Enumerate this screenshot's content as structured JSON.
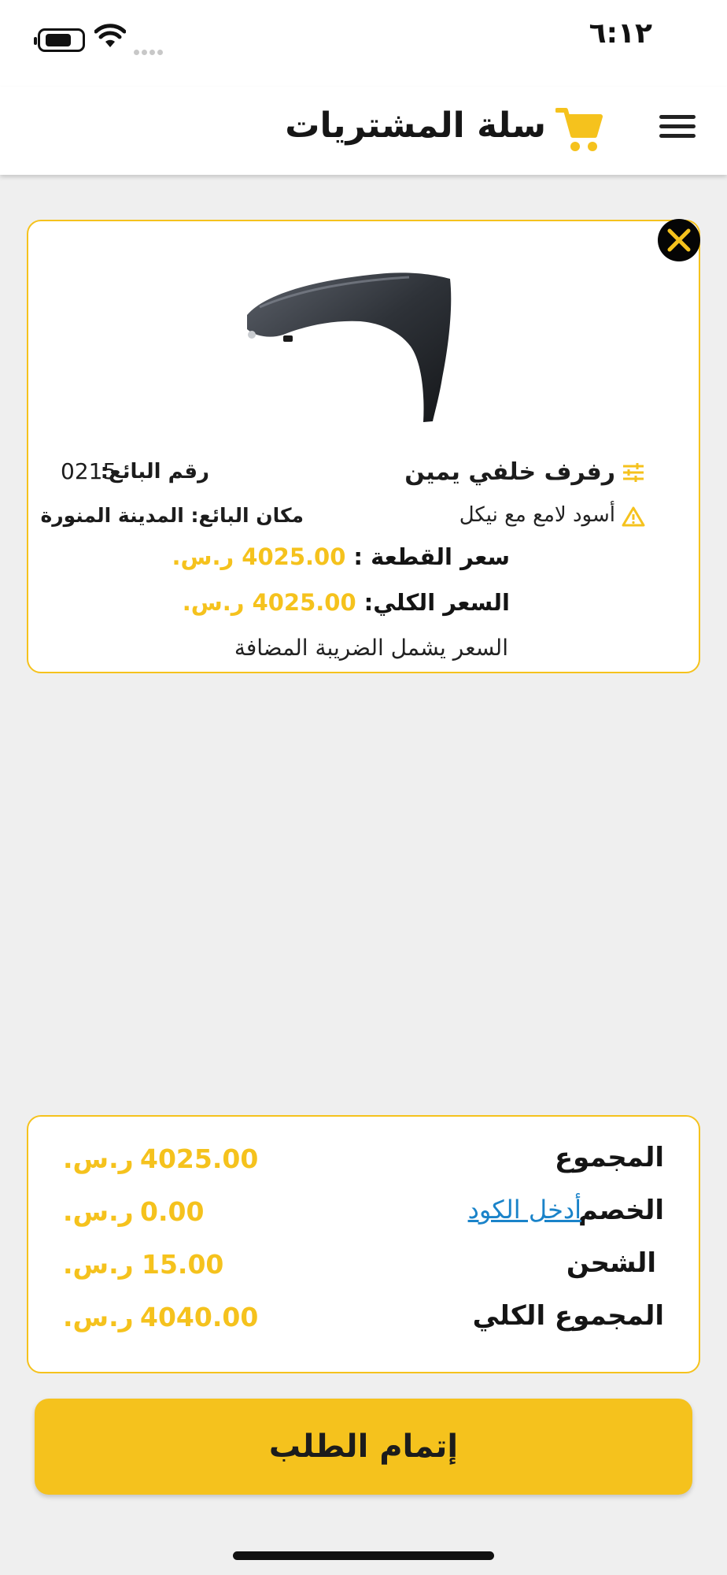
{
  "status_bar": {
    "time": "٦:١٢",
    "icons": [
      "battery-icon",
      "wifi-icon",
      "cellular-signal-icon"
    ]
  },
  "header": {
    "title": "سلة المشتريات",
    "icons": [
      "shopping-cart-icon",
      "hamburger-menu-icon"
    ]
  },
  "cart_item": {
    "image": "car-fender-part-image",
    "name": "رفرف خلفي يمين",
    "color": "أسود لامع مع نيكل",
    "seller_number_label": "رقم البائع:",
    "seller_number": "0215",
    "seller_location": "مكان البائع: المدينة المنورة",
    "unit_price_label": "سعر القطعة :",
    "unit_price": "4025.00 ر.س.",
    "total_price_label": "السعر الكلي:",
    "total_price": "4025.00 ر.س.",
    "tax_note": "السعر يشمل الضريبة المضافة",
    "icons": [
      "close-icon",
      "sliders-icon",
      "warning-icon"
    ]
  },
  "summary": {
    "subtotal": {
      "label": "المجموع",
      "value": "4025.00",
      "currency": "ر.س."
    },
    "discount": {
      "label": "الخصم",
      "coupon_link": "أدخل الكود",
      "value": "0.00",
      "currency": "ر.س."
    },
    "shipping": {
      "label": "الشحن",
      "value": "15.00",
      "currency": "ر.س."
    },
    "grand_total": {
      "label": "المجموع الكلي",
      "value": "4040.00",
      "currency": "ر.س."
    }
  },
  "checkout_button": "إتمام الطلب",
  "colors": {
    "accent": "#f5c21d",
    "link": "#1a83c9",
    "background": "#efefef",
    "text": "#1c1c1c"
  }
}
